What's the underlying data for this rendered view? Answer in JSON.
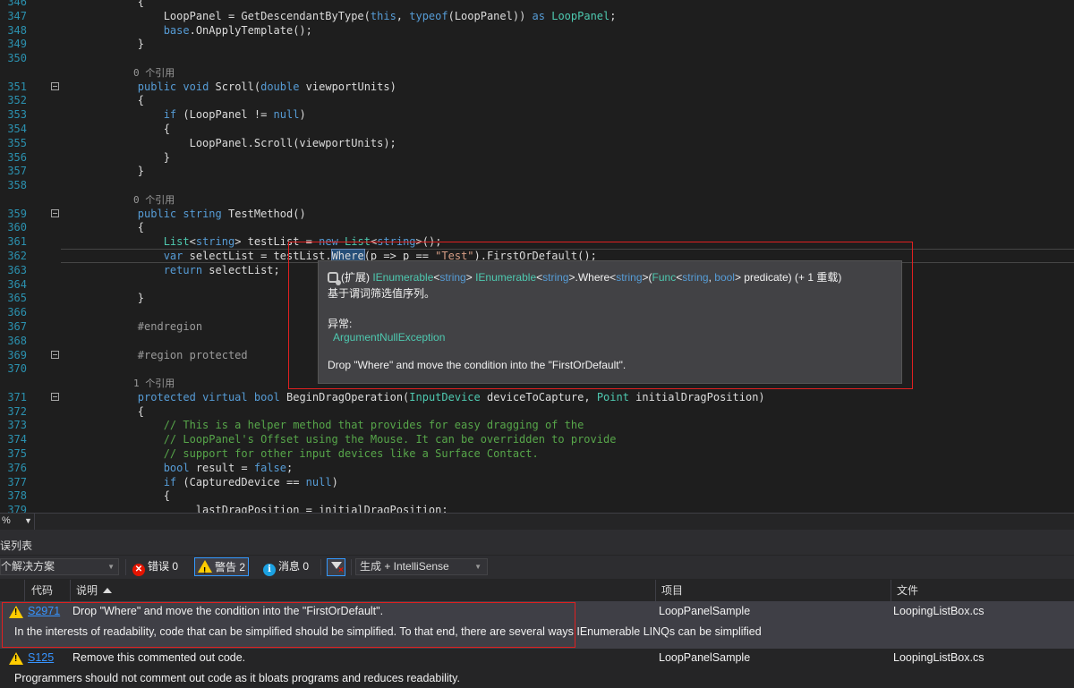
{
  "editor": {
    "lines": [
      {
        "n": "346",
        "fold": false,
        "tokens": [
          {
            "t": "        {",
            "c": ""
          }
        ]
      },
      {
        "n": "347",
        "fold": false,
        "tokens": [
          {
            "t": "            LoopPanel = GetDescendantByType(",
            "c": ""
          },
          {
            "t": "this",
            "c": "kw"
          },
          {
            "t": ", ",
            "c": ""
          },
          {
            "t": "typeof",
            "c": "kw"
          },
          {
            "t": "(LoopPanel)) ",
            "c": ""
          },
          {
            "t": "as",
            "c": "kw"
          },
          {
            "t": " ",
            "c": ""
          },
          {
            "t": "LoopPanel",
            "c": "type"
          },
          {
            "t": ";",
            "c": ""
          }
        ]
      },
      {
        "n": "348",
        "fold": false,
        "tokens": [
          {
            "t": "            ",
            "c": ""
          },
          {
            "t": "base",
            "c": "kw"
          },
          {
            "t": ".OnApplyTemplate();",
            "c": ""
          }
        ]
      },
      {
        "n": "349",
        "fold": false,
        "tokens": [
          {
            "t": "        }",
            "c": ""
          }
        ]
      },
      {
        "n": "350",
        "fold": false,
        "tokens": [
          {
            "t": "",
            "c": ""
          }
        ]
      },
      {
        "n": "",
        "fold": false,
        "lens": true,
        "tokens": [
          {
            "t": "        0 个引用",
            "c": "lens"
          }
        ]
      },
      {
        "n": "351",
        "fold": true,
        "tokens": [
          {
            "t": "        ",
            "c": ""
          },
          {
            "t": "public",
            "c": "kw"
          },
          {
            "t": " ",
            "c": ""
          },
          {
            "t": "void",
            "c": "kw"
          },
          {
            "t": " Scroll(",
            "c": ""
          },
          {
            "t": "double",
            "c": "kw"
          },
          {
            "t": " viewportUnits)",
            "c": ""
          }
        ]
      },
      {
        "n": "352",
        "fold": false,
        "tokens": [
          {
            "t": "        {",
            "c": ""
          }
        ]
      },
      {
        "n": "353",
        "fold": false,
        "tokens": [
          {
            "t": "            ",
            "c": ""
          },
          {
            "t": "if",
            "c": "kw"
          },
          {
            "t": " (LoopPanel != ",
            "c": ""
          },
          {
            "t": "null",
            "c": "kw"
          },
          {
            "t": ")",
            "c": ""
          }
        ]
      },
      {
        "n": "354",
        "fold": false,
        "tokens": [
          {
            "t": "            {",
            "c": ""
          }
        ]
      },
      {
        "n": "355",
        "fold": false,
        "tokens": [
          {
            "t": "                LoopPanel.Scroll(viewportUnits);",
            "c": ""
          }
        ]
      },
      {
        "n": "356",
        "fold": false,
        "tokens": [
          {
            "t": "            }",
            "c": ""
          }
        ]
      },
      {
        "n": "357",
        "fold": false,
        "tokens": [
          {
            "t": "        }",
            "c": ""
          }
        ]
      },
      {
        "n": "358",
        "fold": false,
        "tokens": [
          {
            "t": "",
            "c": ""
          }
        ]
      },
      {
        "n": "",
        "fold": false,
        "lens": true,
        "tokens": [
          {
            "t": "        0 个引用",
            "c": "lens"
          }
        ]
      },
      {
        "n": "359",
        "fold": true,
        "tokens": [
          {
            "t": "        ",
            "c": ""
          },
          {
            "t": "public",
            "c": "kw"
          },
          {
            "t": " ",
            "c": ""
          },
          {
            "t": "string",
            "c": "kw"
          },
          {
            "t": " TestMethod()",
            "c": ""
          }
        ]
      },
      {
        "n": "360",
        "fold": false,
        "tokens": [
          {
            "t": "        {",
            "c": ""
          }
        ]
      },
      {
        "n": "361",
        "fold": false,
        "tokens": [
          {
            "t": "            ",
            "c": ""
          },
          {
            "t": "List",
            "c": "type"
          },
          {
            "t": "<",
            "c": ""
          },
          {
            "t": "string",
            "c": "kw"
          },
          {
            "t": "> testList = ",
            "c": ""
          },
          {
            "t": "new",
            "c": "kw"
          },
          {
            "t": " ",
            "c": ""
          },
          {
            "t": "List",
            "c": "type"
          },
          {
            "t": "<",
            "c": ""
          },
          {
            "t": "string",
            "c": "kw"
          },
          {
            "t": ">();",
            "c": ""
          }
        ]
      },
      {
        "n": "362",
        "fold": false,
        "current": true,
        "tokens": [
          {
            "t": "            ",
            "c": ""
          },
          {
            "t": "var",
            "c": "kw"
          },
          {
            "t": " selectList = testList.",
            "c": ""
          },
          {
            "t": "Where",
            "c": "hl"
          },
          {
            "t": "(p => p == ",
            "c": ""
          },
          {
            "t": "\"Test\"",
            "c": "str"
          },
          {
            "t": ").FirstOrDefault();",
            "c": ""
          }
        ]
      },
      {
        "n": "363",
        "fold": false,
        "tokens": [
          {
            "t": "            ",
            "c": ""
          },
          {
            "t": "return",
            "c": "kw"
          },
          {
            "t": " selectList;",
            "c": ""
          }
        ]
      },
      {
        "n": "364",
        "fold": false,
        "tokens": [
          {
            "t": "",
            "c": ""
          }
        ]
      },
      {
        "n": "365",
        "fold": false,
        "tokens": [
          {
            "t": "        }",
            "c": ""
          }
        ]
      },
      {
        "n": "366",
        "fold": false,
        "tokens": [
          {
            "t": "",
            "c": ""
          }
        ]
      },
      {
        "n": "367",
        "fold": false,
        "tokens": [
          {
            "t": "        #endregion",
            "c": "pre"
          }
        ]
      },
      {
        "n": "368",
        "fold": false,
        "tokens": [
          {
            "t": "",
            "c": ""
          }
        ]
      },
      {
        "n": "369",
        "fold": true,
        "tokens": [
          {
            "t": "        ",
            "c": ""
          },
          {
            "t": "#region protected",
            "c": "pre"
          }
        ]
      },
      {
        "n": "370",
        "fold": false,
        "tokens": [
          {
            "t": "",
            "c": ""
          }
        ]
      },
      {
        "n": "",
        "fold": false,
        "lens": true,
        "tokens": [
          {
            "t": "        1 个引用",
            "c": "lens"
          }
        ]
      },
      {
        "n": "371",
        "fold": true,
        "tokens": [
          {
            "t": "        ",
            "c": ""
          },
          {
            "t": "protected",
            "c": "kw"
          },
          {
            "t": " ",
            "c": ""
          },
          {
            "t": "virtual",
            "c": "kw"
          },
          {
            "t": " ",
            "c": ""
          },
          {
            "t": "bool",
            "c": "kw"
          },
          {
            "t": " BeginDragOperation(",
            "c": ""
          },
          {
            "t": "InputDevice",
            "c": "type"
          },
          {
            "t": " deviceToCapture, ",
            "c": ""
          },
          {
            "t": "Point",
            "c": "type"
          },
          {
            "t": " initialDragPosition)",
            "c": ""
          }
        ]
      },
      {
        "n": "372",
        "fold": false,
        "tokens": [
          {
            "t": "        {",
            "c": ""
          }
        ]
      },
      {
        "n": "373",
        "fold": false,
        "tokens": [
          {
            "t": "            // This is a helper method that provides for easy dragging of the",
            "c": "com"
          }
        ]
      },
      {
        "n": "374",
        "fold": false,
        "tokens": [
          {
            "t": "            // LoopPanel's Offset using the Mouse. It can be overridden to provide",
            "c": "com"
          }
        ]
      },
      {
        "n": "375",
        "fold": false,
        "tokens": [
          {
            "t": "            // support for other input devices like a Surface Contact.",
            "c": "com"
          }
        ]
      },
      {
        "n": "376",
        "fold": false,
        "tokens": [
          {
            "t": "            ",
            "c": ""
          },
          {
            "t": "bool",
            "c": "kw"
          },
          {
            "t": " result = ",
            "c": ""
          },
          {
            "t": "false",
            "c": "kw"
          },
          {
            "t": ";",
            "c": ""
          }
        ]
      },
      {
        "n": "377",
        "fold": false,
        "tokens": [
          {
            "t": "            ",
            "c": ""
          },
          {
            "t": "if",
            "c": "kw"
          },
          {
            "t": " (CapturedDevice == ",
            "c": ""
          },
          {
            "t": "null",
            "c": "kw"
          },
          {
            "t": ")",
            "c": ""
          }
        ]
      },
      {
        "n": "378",
        "fold": false,
        "tokens": [
          {
            "t": "            {",
            "c": ""
          }
        ]
      },
      {
        "n": "379",
        "fold": false,
        "tokens": [
          {
            "t": "                _lastDragPosition = initialDragPosition;",
            "c": ""
          }
        ]
      }
    ]
  },
  "tooltip": {
    "sig_prefix": "(扩展) ",
    "sig_parts": [
      {
        "t": "IEnumerable",
        "c": "teal"
      },
      {
        "t": "<",
        "c": ""
      },
      {
        "t": "string",
        "c": "blue"
      },
      {
        "t": "> ",
        "c": ""
      },
      {
        "t": "IEnumerable",
        "c": "teal"
      },
      {
        "t": "<",
        "c": ""
      },
      {
        "t": "string",
        "c": "blue"
      },
      {
        "t": ">.Where<",
        "c": ""
      },
      {
        "t": "string",
        "c": "blue"
      },
      {
        "t": ">(",
        "c": ""
      },
      {
        "t": "Func",
        "c": "teal"
      },
      {
        "t": "<",
        "c": ""
      },
      {
        "t": "string",
        "c": "blue"
      },
      {
        "t": ", ",
        "c": ""
      },
      {
        "t": "bool",
        "c": "blue"
      },
      {
        "t": "> predicate) (+ 1 重载)",
        "c": ""
      }
    ],
    "summary": "基于谓词筛选值序列。",
    "exceptions_label": "异常:",
    "exception": "ArgumentNullException",
    "suggestion": "Drop \"Where\" and move the condition into the \"FirstOrDefault\"."
  },
  "zoom": {
    "value": "%"
  },
  "error_list": {
    "title": "误列表",
    "scope": "个解决方案",
    "errors_label": "错误 0",
    "warnings_label": "警告 2",
    "messages_label": "消息 0",
    "build_filter": "生成 + IntelliSense",
    "columns": {
      "code": "代码",
      "description": "说明",
      "project": "项目",
      "file": "文件"
    },
    "rows": [
      {
        "code": "S2971",
        "description": "Drop \"Where\" and move the condition into the \"FirstOrDefault\".",
        "project": "LoopPanelSample",
        "file": "LoopingListBox.cs",
        "detail": "In the interests of readability, code that can be simplified should be simplified. To that end, there are several ways IEnumerable LINQs can be simplified"
      },
      {
        "code": "S125",
        "description": "Remove this commented out code.",
        "project": "LoopPanelSample",
        "file": "LoopingListBox.cs",
        "detail": "Programmers should not comment out code as it bloats programs and reduces readability."
      }
    ]
  },
  "colors": {
    "accent": "#3399ff",
    "error": "#e51400",
    "warning": "#ffcc00",
    "info": "#1ba1e2",
    "highlight_box": "#e02020"
  }
}
